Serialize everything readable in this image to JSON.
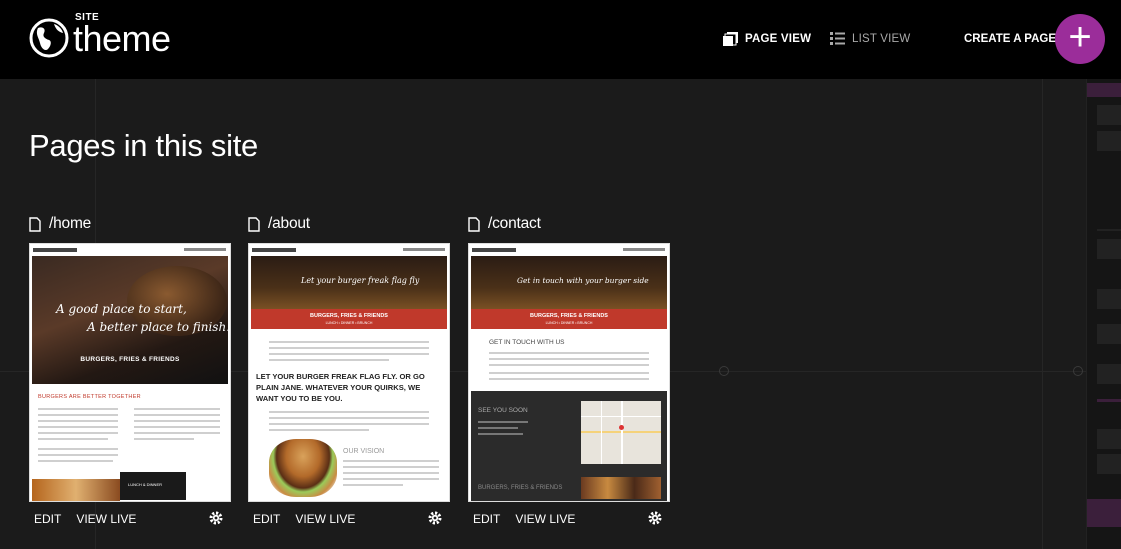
{
  "header": {
    "logo_small": "SITE",
    "logo_big": "theme",
    "page_view_label": "PAGE VIEW",
    "list_view_label": "LIST VIEW",
    "create_label": "CREATE A PAGE",
    "create_symbol": "+"
  },
  "main": {
    "title": "Pages in this site"
  },
  "pages": [
    {
      "path": "/home",
      "edit_label": "EDIT",
      "view_label": "VIEW LIVE",
      "thumb": {
        "hero_line1": "A good place to start,",
        "hero_line2": "A better place to finish.",
        "brand": "BURGERS, FRIES & FRIENDS",
        "section_heading": "BURGERS ARE BETTER TOGETHER",
        "footer_tag": "LUNCH & DINNER"
      }
    },
    {
      "path": "/about",
      "edit_label": "EDIT",
      "view_label": "VIEW LIVE",
      "thumb": {
        "hero_line1": "Let your burger freak flag fly",
        "brand": "BURGERS, FRIES & FRIENDS",
        "sub_brand": "LUNCH • DINNER • BRUNCH",
        "headline": "LET YOUR BURGER FREAK FLAG FLY. OR GO PLAIN JANE. WHATEVER YOUR QUIRKS, WE WANT YOU TO BE YOU.",
        "vision_label": "OUR VISION"
      }
    },
    {
      "path": "/contact",
      "edit_label": "EDIT",
      "view_label": "VIEW LIVE",
      "thumb": {
        "hero_line1": "Get in touch with your burger side",
        "brand": "BURGERS, FRIES & FRIENDS",
        "sub_brand": "LUNCH • DINNER • BRUNCH",
        "section_heading": "GET IN TOUCH WITH US",
        "see_you": "SEE YOU SOON",
        "footer_brand": "BURGERS, FRIES & FRIENDS"
      }
    }
  ],
  "colors": {
    "accent": "#9b2d9a",
    "brand_red": "#c0392b",
    "background": "#1b1b1b"
  }
}
